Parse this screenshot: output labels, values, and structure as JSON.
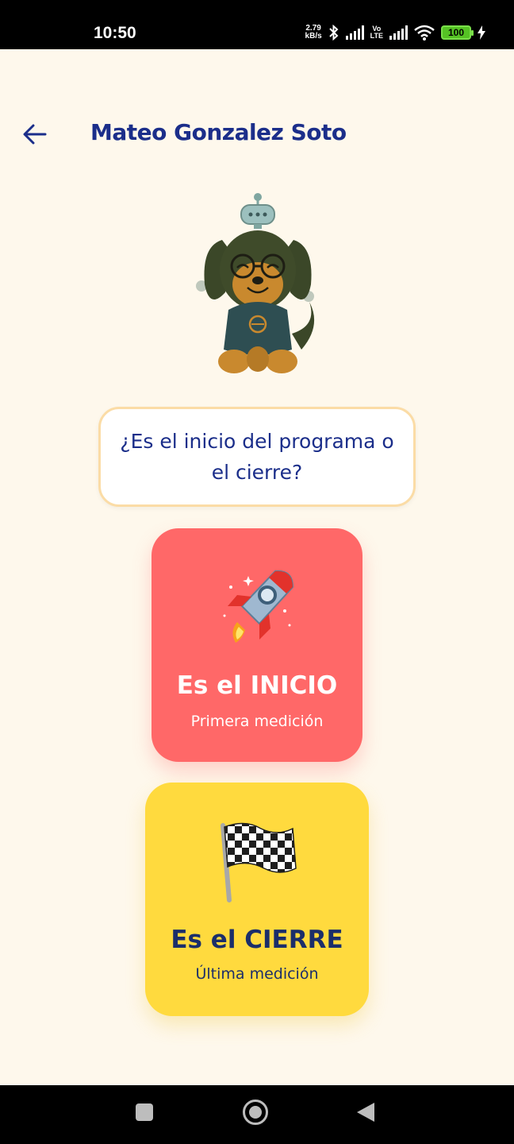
{
  "status_bar": {
    "time": "10:50",
    "net_speed_value": "2.79",
    "net_speed_unit": "kB/s",
    "volte_top": "Vo",
    "volte_bottom": "LTE",
    "battery": "100"
  },
  "header": {
    "title": "Mateo Gonzalez Soto",
    "back_icon": "arrow-left-icon"
  },
  "mascot": {
    "icon": "dog-mascot-illustration"
  },
  "question": {
    "text": "¿Es el inicio del programa o el cierre?"
  },
  "options": [
    {
      "icon": "rocket-icon",
      "title": "Es el INICIO",
      "subtitle": "Primera medición",
      "color": "#FF6868"
    },
    {
      "icon": "checkered-flag-icon",
      "title": "Es el CIERRE",
      "subtitle": "Última medición",
      "color": "#FFDA3E"
    }
  ],
  "colors": {
    "background": "#FEF8EC",
    "title": "#1B2E8A",
    "bubble_border": "#FBDCA6"
  }
}
